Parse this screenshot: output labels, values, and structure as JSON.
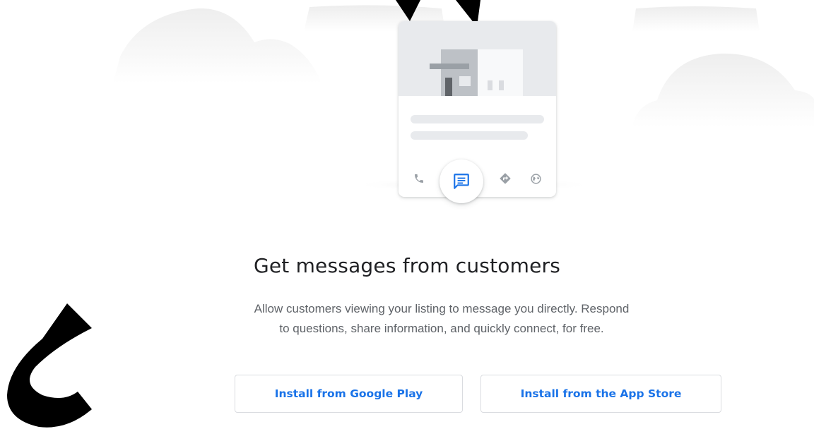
{
  "illustration": {
    "icons": {
      "phone": "phone-icon",
      "message": "message-icon",
      "directions": "directions-icon",
      "website": "globe-icon"
    }
  },
  "main": {
    "title": "Get messages from customers",
    "description_line1": "Allow customers viewing your listing to message you directly. Respond",
    "description_line2": "to questions, share information, and quickly connect, for free."
  },
  "actions": {
    "google_play_label": "Install from Google Play",
    "app_store_label": "Install from the App Store"
  },
  "colors": {
    "accent": "#1a73e8",
    "title": "#202124",
    "body_text": "#5f6368",
    "border": "#dadce0",
    "placeholder": "#e8eaed"
  }
}
